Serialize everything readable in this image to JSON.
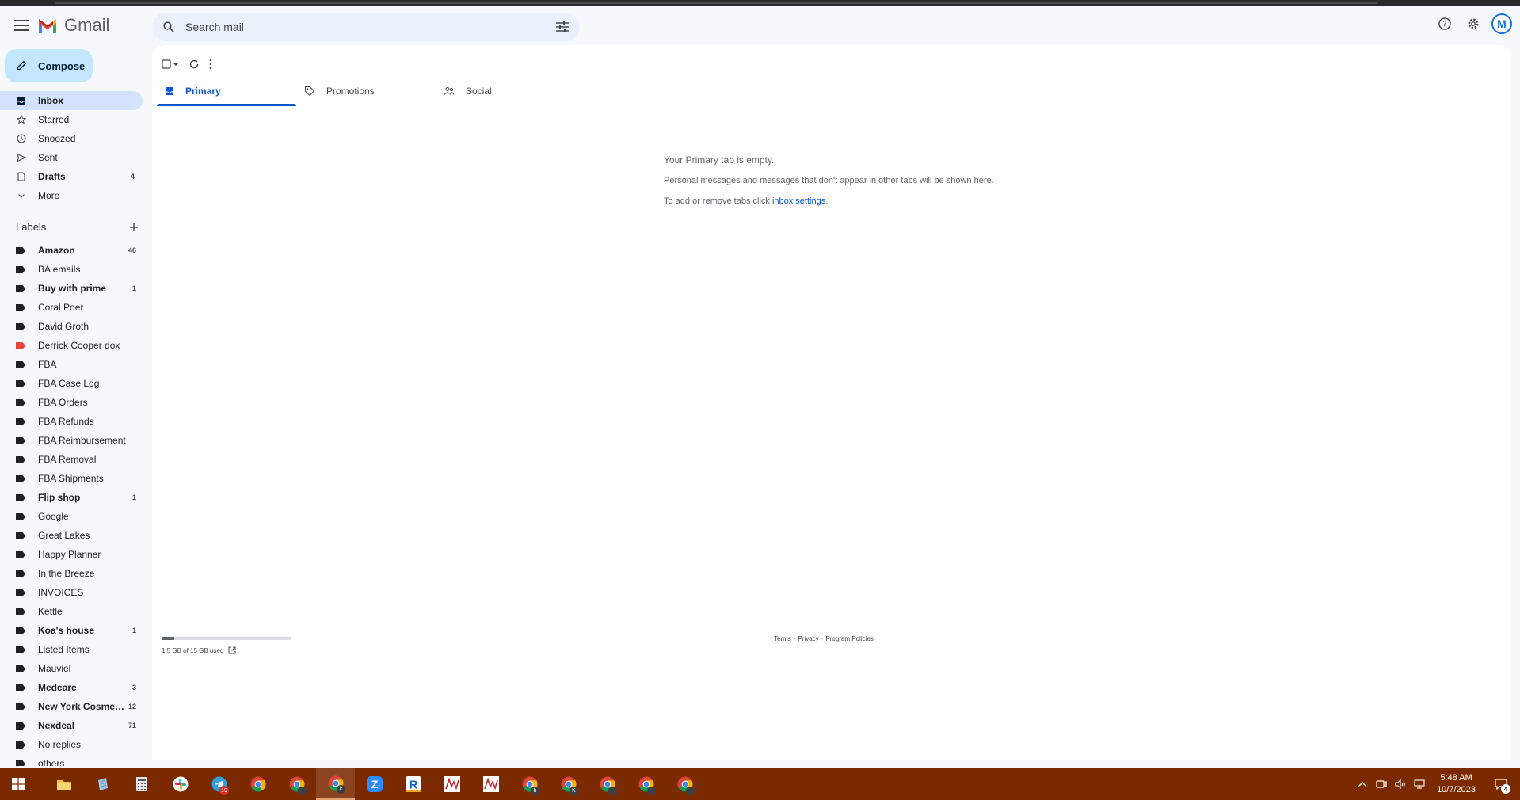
{
  "header": {
    "app_name": "Gmail",
    "search_placeholder": "Search mail",
    "avatar_letter": "M"
  },
  "compose": {
    "label": "Compose"
  },
  "nav": [
    {
      "label": "Inbox",
      "count": "",
      "icon": "inbox-icon",
      "active": true
    },
    {
      "label": "Starred",
      "count": "",
      "icon": "star-icon"
    },
    {
      "label": "Snoozed",
      "count": "",
      "icon": "clock-icon"
    },
    {
      "label": "Sent",
      "count": "",
      "icon": "send-icon"
    },
    {
      "label": "Drafts",
      "count": "4",
      "icon": "draft-icon",
      "bold": true
    },
    {
      "label": "More",
      "count": "",
      "icon": "chevron-down-icon"
    }
  ],
  "labels_heading": "Labels",
  "labels": [
    {
      "label": "Amazon",
      "count": "46",
      "bold": true,
      "color": "#202124"
    },
    {
      "label": "BA emails",
      "count": "",
      "color": "#202124"
    },
    {
      "label": "Buy with prime",
      "count": "1",
      "bold": true,
      "color": "#202124"
    },
    {
      "label": "Coral Poer",
      "count": "",
      "color": "#202124"
    },
    {
      "label": "David Groth",
      "count": "",
      "color": "#202124"
    },
    {
      "label": "Derrick Cooper dox",
      "count": "",
      "color": "#e8453c"
    },
    {
      "label": "FBA",
      "count": "",
      "color": "#202124"
    },
    {
      "label": "FBA Case Log",
      "count": "",
      "color": "#202124"
    },
    {
      "label": "FBA Orders",
      "count": "",
      "color": "#202124"
    },
    {
      "label": "FBA Refunds",
      "count": "",
      "color": "#202124"
    },
    {
      "label": "FBA Reimbursement",
      "count": "",
      "color": "#202124"
    },
    {
      "label": "FBA Removal",
      "count": "",
      "color": "#202124"
    },
    {
      "label": "FBA Shipments",
      "count": "",
      "color": "#202124"
    },
    {
      "label": "Flip shop",
      "count": "1",
      "bold": true,
      "color": "#202124"
    },
    {
      "label": "Google",
      "count": "",
      "color": "#202124"
    },
    {
      "label": "Great Lakes",
      "count": "",
      "color": "#202124"
    },
    {
      "label": "Happy Planner",
      "count": "",
      "color": "#202124"
    },
    {
      "label": "In the Breeze",
      "count": "",
      "color": "#202124"
    },
    {
      "label": "INVOICES",
      "count": "",
      "color": "#202124"
    },
    {
      "label": "Kettle",
      "count": "",
      "color": "#202124"
    },
    {
      "label": "Koa's house",
      "count": "1",
      "bold": true,
      "color": "#202124"
    },
    {
      "label": "Listed Items",
      "count": "",
      "color": "#202124"
    },
    {
      "label": "Mauviel",
      "count": "",
      "color": "#202124"
    },
    {
      "label": "Medcare",
      "count": "3",
      "bold": true,
      "color": "#202124"
    },
    {
      "label": "New York Cosmet...",
      "count": "12",
      "bold": true,
      "color": "#202124"
    },
    {
      "label": "Nexdeal",
      "count": "71",
      "bold": true,
      "color": "#202124"
    },
    {
      "label": "No replies",
      "count": "",
      "color": "#202124"
    },
    {
      "label": "others",
      "count": "",
      "color": "#202124"
    }
  ],
  "tabs": [
    {
      "label": "Primary",
      "icon": "inbox-icon",
      "active": true
    },
    {
      "label": "Promotions",
      "icon": "tag-icon"
    },
    {
      "label": "Social",
      "icon": "people-icon"
    }
  ],
  "empty": {
    "title": "Your Primary tab is empty.",
    "body": "Personal messages and messages that don't appear in other tabs will be shown here.",
    "settings_prefix": "To add or remove tabs click ",
    "settings_link": "inbox settings",
    "settings_suffix": "."
  },
  "storage": {
    "text": "1.5 GB of 15 GB used",
    "used_fraction": 0.1
  },
  "footer": {
    "terms": "Terms",
    "privacy": "Privacy",
    "policies": "Program Policies",
    "sep": "·"
  },
  "taskbar": {
    "apps": [
      {
        "name": "file-explorer-icon",
        "color": "#f2c04b"
      },
      {
        "name": "notepad-icon",
        "color": "#9ec7e8"
      },
      {
        "name": "calculator-icon",
        "color": "#e8e8e8"
      },
      {
        "name": "slack-icon",
        "color": "#e01e5a"
      },
      {
        "name": "telegram-icon",
        "color": "#2aa3e0",
        "badge": "19"
      },
      {
        "name": "chrome-icon",
        "color": "#34a853"
      },
      {
        "name": "chrome-profile-icon",
        "color": "#34a853"
      },
      {
        "name": "chrome-active-icon",
        "color": "#34a853",
        "active": true
      },
      {
        "name": "zoom-icon",
        "color": "#2d8cff"
      },
      {
        "name": "r-app-icon",
        "color": "#f9a825"
      },
      {
        "name": "chart-app-icon",
        "color": "#c62828"
      },
      {
        "name": "chart-app-2-icon",
        "color": "#c62828"
      },
      {
        "name": "chrome-blue-icon",
        "color": "#4285f4"
      },
      {
        "name": "chrome-k-icon",
        "color": "#34a853"
      },
      {
        "name": "chrome-2-icon",
        "color": "#34a853"
      },
      {
        "name": "chrome-3-icon",
        "color": "#34a853"
      },
      {
        "name": "chrome-4-icon",
        "color": "#34a853"
      }
    ],
    "time": "5:48 AM",
    "date": "10/7/2023",
    "notifications": "4"
  }
}
